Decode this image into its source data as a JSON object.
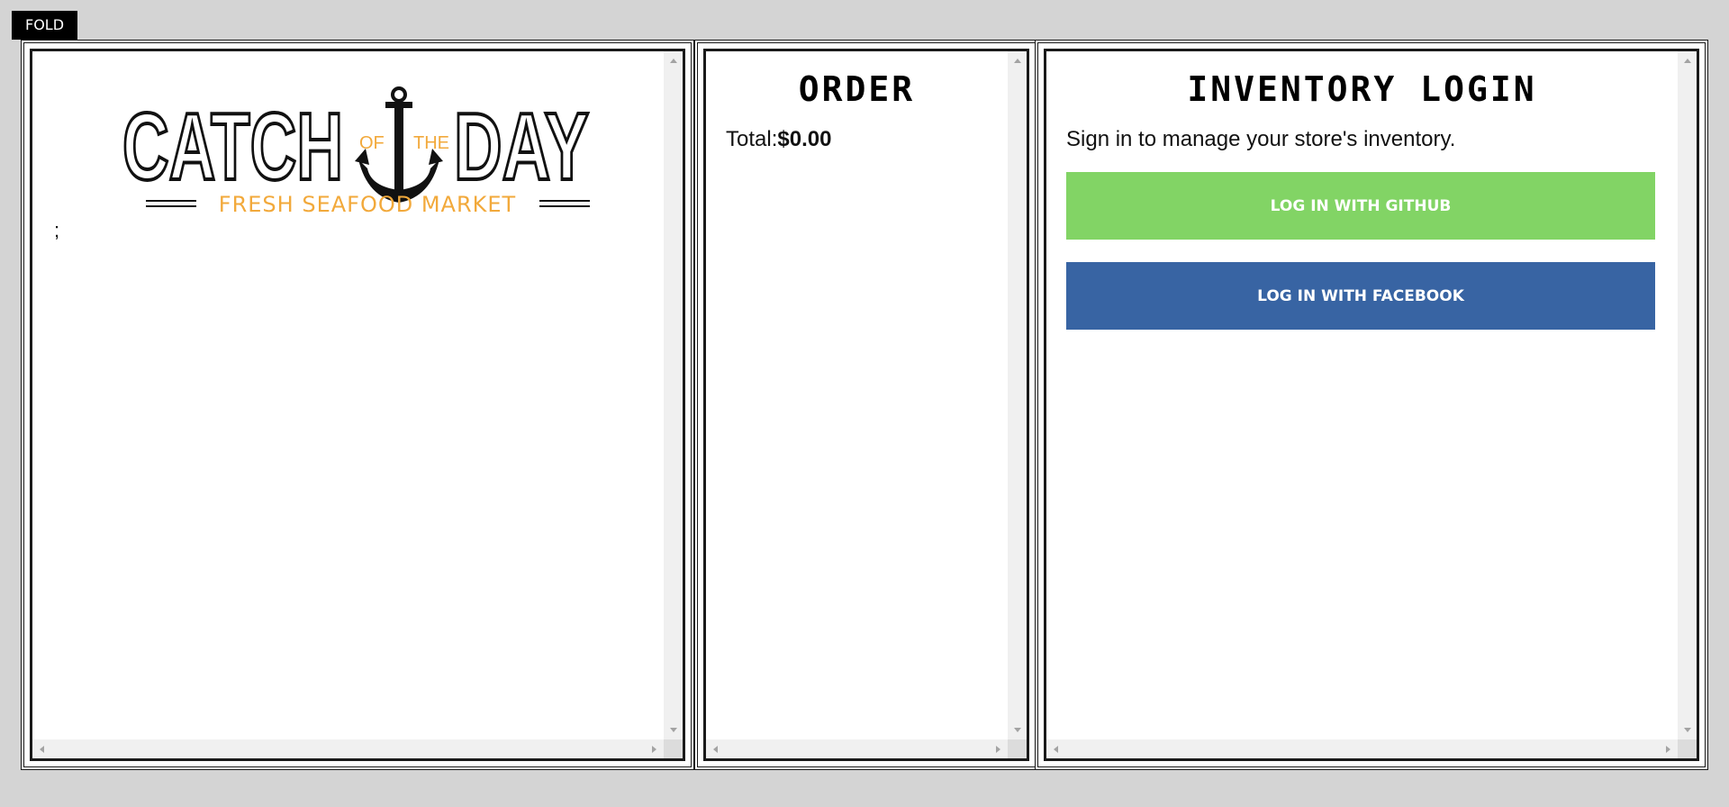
{
  "toolbar": {
    "fold_label": "FOLD"
  },
  "menu": {
    "logo": {
      "word_left": "CATCH",
      "word_mid_left": "OF",
      "word_mid_right": "THE",
      "word_right": "DAY",
      "tagline": "FRESH SEAFOOD MARKET"
    },
    "fish_list_text": ";"
  },
  "order": {
    "title": "ORDER",
    "total_label": "Total:",
    "total_amount": "$0.00"
  },
  "inventory": {
    "title": "INVENTORY LOGIN",
    "description": "Sign in to manage your store's inventory.",
    "github_label": "LOG IN WITH GITHUB",
    "facebook_label": "LOG IN WITH FACEBOOK"
  },
  "colors": {
    "logo_dark": "#111111",
    "logo_accent": "#f2a93b",
    "github": "#82d465",
    "facebook": "#3864a3"
  },
  "icons": {
    "logo_mark": "anchor-icon"
  }
}
